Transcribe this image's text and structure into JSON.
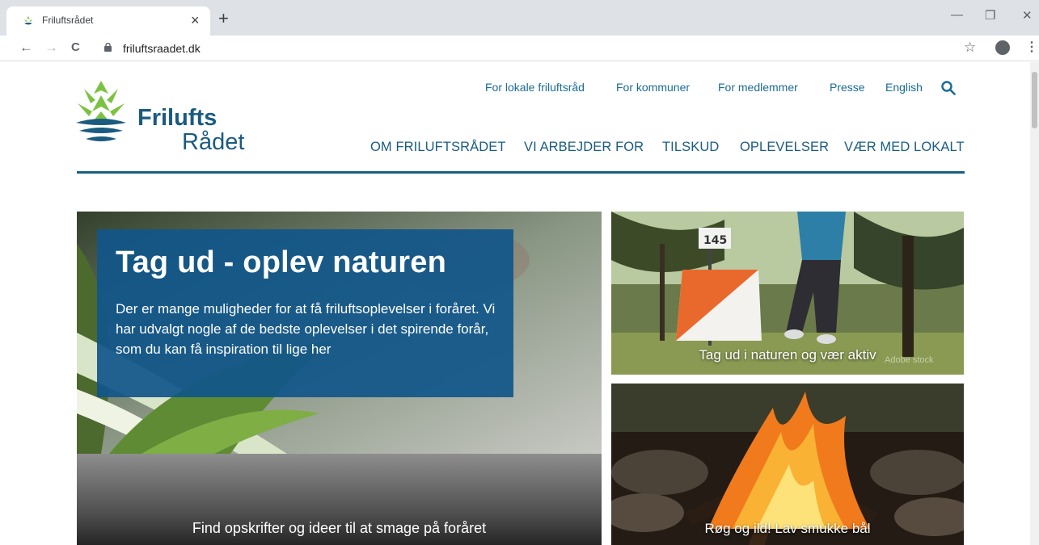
{
  "browser": {
    "tab_title": "Friluftsrådet",
    "tab_close": "×",
    "new_tab": "+",
    "minimize": "—",
    "restore": "❐",
    "close": "✕",
    "back": "←",
    "forward": "→",
    "reload": "C",
    "url": "friluftsraadet.dk",
    "bookmark_star": "☆",
    "menu": "⋮"
  },
  "logo": {
    "word1": "Frilufts",
    "word2": "Rådet",
    "colors": {
      "primary": "#1a5b80",
      "leaf": "#7cc242",
      "wave": "#1a5b80"
    }
  },
  "util_nav": [
    "For lokale friluftsråd",
    "For kommuner",
    "For medlemmer",
    "Presse",
    "English"
  ],
  "main_nav": [
    "OM FRILUFTSRÅDET",
    "VI ARBEJDER FOR",
    "TILSKUD",
    "OPLEVELSER",
    "VÆR MED LOKALT"
  ],
  "hero": {
    "title": "Tag ud - oplev naturen",
    "text": "Der er mange muligheder for at få friluftsoplevelser i foråret. Vi har udvalgt nogle af de bedste oplevelser i det spirende forår, som du kan få inspiration til lige her",
    "caption": "Find opskrifter og ideer til at smage på foråret"
  },
  "cards": [
    {
      "caption": "Tag ud i naturen og vær aktiv",
      "watermark": "Adobe stock",
      "post_number": "145"
    },
    {
      "caption": "Røg og ild! Lav smukke bål"
    }
  ],
  "colors": {
    "accent": "#1a5b80",
    "hero_box": "#10568a",
    "tab_strip": "#dee1e6"
  }
}
